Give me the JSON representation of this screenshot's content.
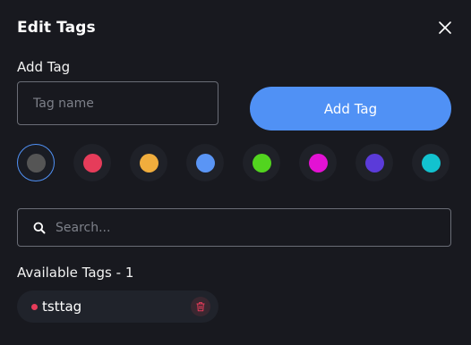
{
  "dialog": {
    "title": "Edit Tags",
    "close_icon": "close-icon"
  },
  "add_tag": {
    "section_label": "Add Tag",
    "input_value": "",
    "input_placeholder": "Tag name",
    "button_label": "Add Tag",
    "button_color": "#5091f5"
  },
  "color_palette": {
    "selected_index": 0,
    "colors": [
      "#555555",
      "#e63c5a",
      "#f0ad3d",
      "#5a95f5",
      "#52d41f",
      "#e312d4",
      "#5b3bd9",
      "#12c2cf"
    ]
  },
  "search": {
    "icon": "search-icon",
    "value": "",
    "placeholder": "Search..."
  },
  "available_tags": {
    "label": "Available Tags - 1",
    "items": [
      {
        "name": "tsttag",
        "color": "#e63c5a",
        "delete_icon": "trash-icon"
      }
    ]
  }
}
